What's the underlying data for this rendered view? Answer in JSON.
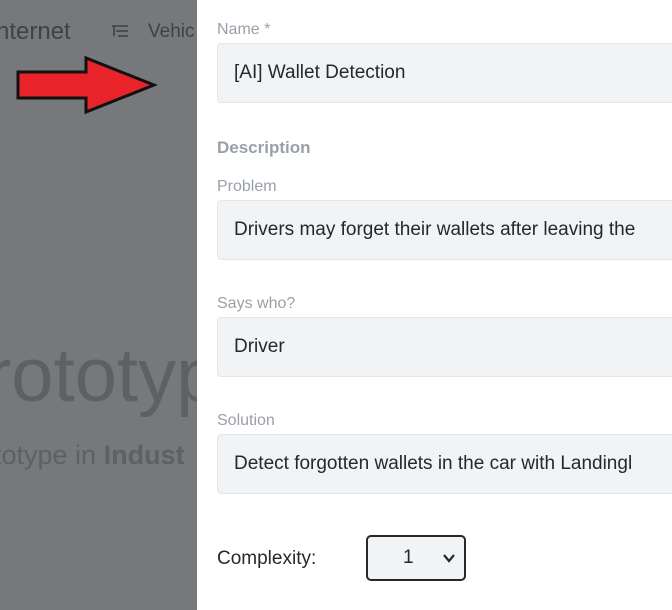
{
  "background": {
    "nav_partial_text": "nternet",
    "nav_item": "Vehic",
    "nav_icon": "list-icon",
    "hero_partial": "rototyp",
    "sub_prefix": "totype in ",
    "sub_bold": "Indust"
  },
  "annotation": {
    "arrow_icon": "right-arrow-icon",
    "arrow_color": "#e8232a"
  },
  "form": {
    "name_label": "Name *",
    "name_value": "[AI] Wallet Detection",
    "description_heading": "Description",
    "problem_label": "Problem",
    "problem_value": "Drivers may forget their wallets after leaving the",
    "says_who_label": "Says who?",
    "says_who_value": "Driver",
    "solution_label": "Solution",
    "solution_value": "Detect forgotten wallets in the car with Landingl",
    "complexity_label": "Complexity:",
    "complexity_value": "1",
    "complexity_icon": "chevron-down-icon"
  }
}
